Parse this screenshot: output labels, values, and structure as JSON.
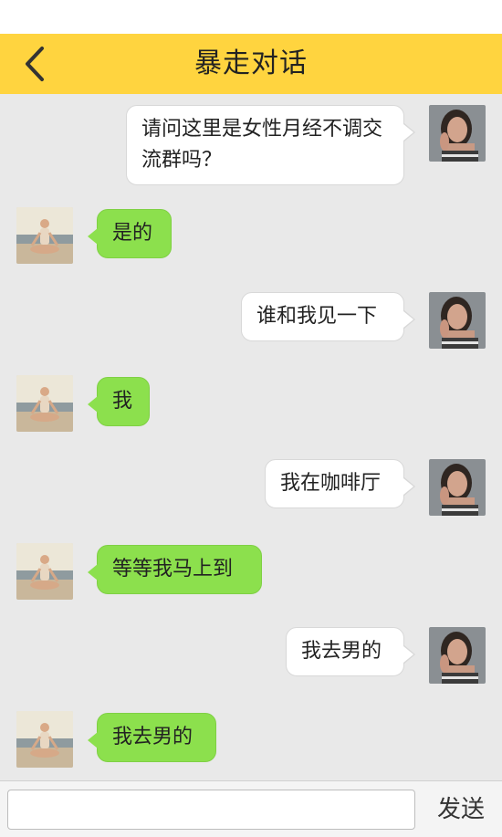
{
  "header": {
    "title": "暴走对话",
    "back_icon": "chevron-left-icon"
  },
  "messages": [
    {
      "side": "right",
      "text": "请问这里是女性月经不调交流群吗？",
      "avatar": "woman-portrait-avatar"
    },
    {
      "side": "left",
      "text": "是的",
      "avatar": "yoga-woman-avatar"
    },
    {
      "side": "right",
      "text": "谁和我见一下",
      "avatar": "woman-portrait-avatar"
    },
    {
      "side": "left",
      "text": "我",
      "avatar": "yoga-woman-avatar"
    },
    {
      "side": "right",
      "text": "我在咖啡厅",
      "avatar": "woman-portrait-avatar"
    },
    {
      "side": "left",
      "text": "等等我马上到",
      "avatar": "yoga-woman-avatar"
    },
    {
      "side": "right",
      "text": "我去男的",
      "avatar": "woman-portrait-avatar"
    },
    {
      "side": "left",
      "text": "我去男的",
      "avatar": "yoga-woman-avatar"
    }
  ],
  "composer": {
    "input_value": "",
    "send_label": "发送"
  },
  "colors": {
    "header_bg": "#ffd43f",
    "chat_bg": "#e9e9e9",
    "bubble_left": "#8ce04d",
    "bubble_right": "#ffffff"
  }
}
